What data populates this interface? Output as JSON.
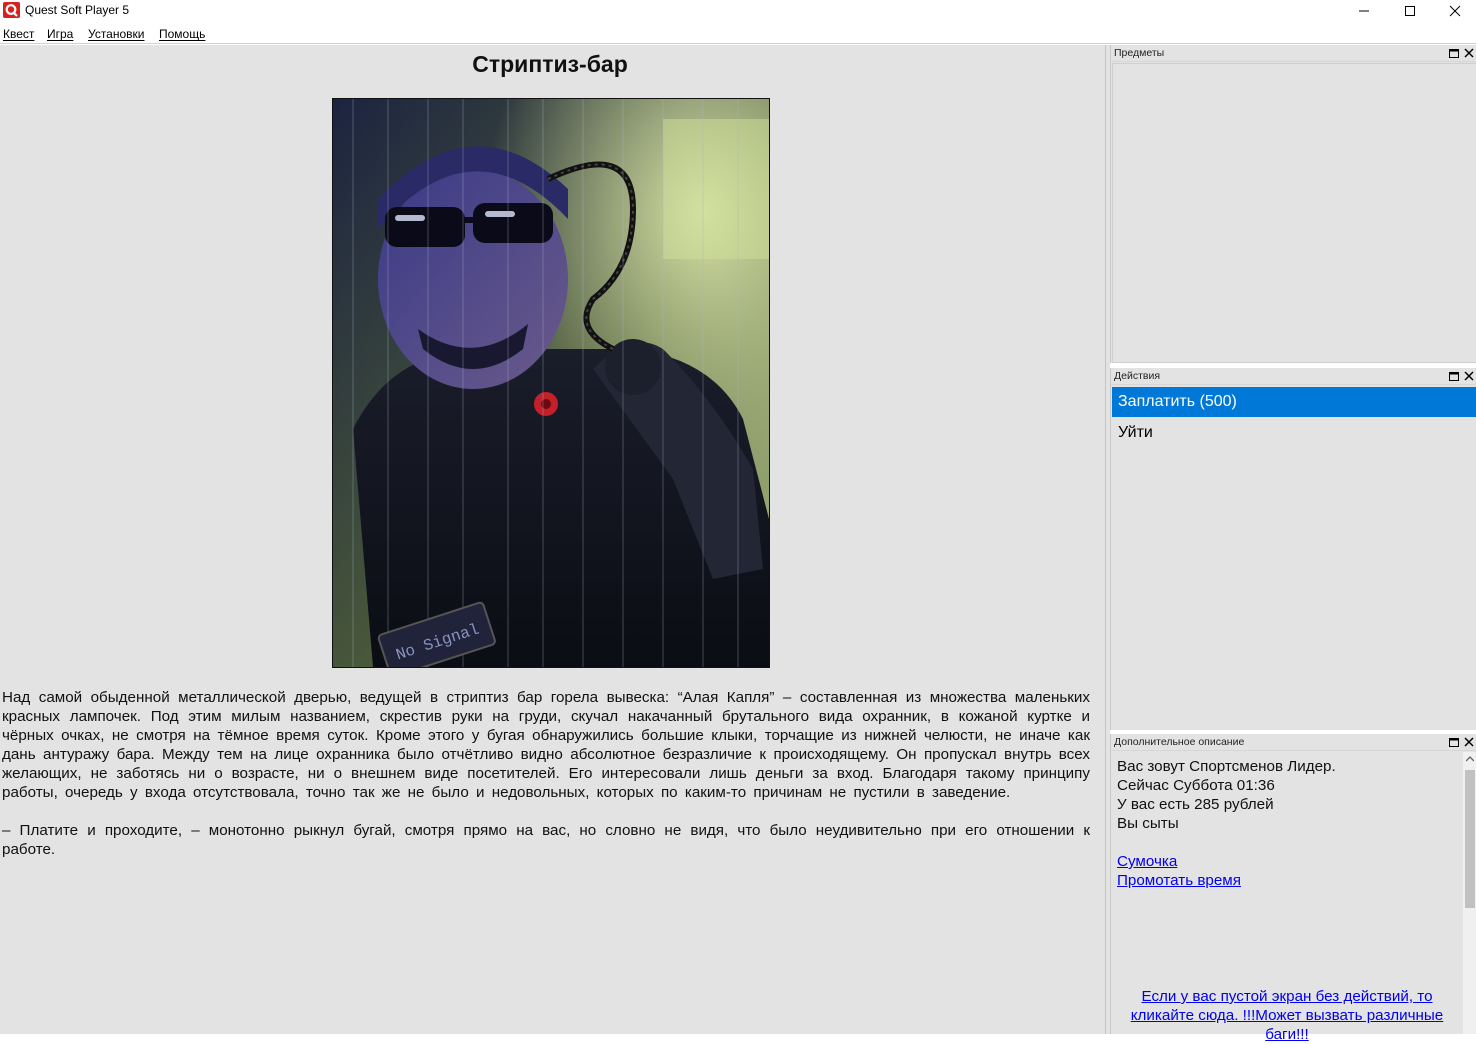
{
  "window": {
    "title": "Quest Soft Player 5"
  },
  "menu": {
    "items": [
      {
        "label": "Квест"
      },
      {
        "label": "Игра"
      },
      {
        "label": "Установки"
      },
      {
        "label": "Помощь"
      }
    ]
  },
  "scene": {
    "title": "Стриптиз-бар",
    "image_badge": "No Signal",
    "paragraphs": [
      "Над самой обыденной металлической дверью, ведущей в стриптиз бар горела вывеска: “Алая Капля” – составленная из множества маленьких красных лампочек. Под этим милым названием, скрестив руки на груди, скучал накачанный брутального вида охранник, в кожаной куртке и чёрных очках, не смотря на тёмное время суток. Кроме этого у бугая обнаружились большие клыки, торчащие из нижней челюсти, не иначе как дань антуражу бара. Между тем на лице охранника было отчётливо видно абсолютное безразличие к происходящему. Он пропускал внутрь всех желающих, не заботясь ни о возрасте, ни о внешнем виде посетителей. Его интересовали лишь деньги за вход. Благодаря такому принципу работы, очередь у входа отсутствовала, точно так же не было и недовольных, которых по каким-то причинам не пустили в заведение.",
      "– Платите и проходите, – монотонно рыкнул бугай, смотря прямо на вас, но словно не видя, что было неудивительно при его отношении к работе."
    ]
  },
  "panels": {
    "items": {
      "title": "Предметы"
    },
    "actions": {
      "title": "Действия",
      "list": [
        {
          "label": "Заплатить (500)",
          "selected": true
        },
        {
          "label": "Уйти",
          "selected": false
        }
      ]
    },
    "description": {
      "title": "Дополнительное описание",
      "lines": [
        "Вас зовут Спортсменов Лидер.",
        "Сейчас Суббота 01:36",
        "У вас есть 285 рублей",
        "Вы сыты"
      ],
      "links": [
        "Сумочка",
        "Промотать время"
      ],
      "warning": "Если у вас пустой экран без действий, то кликайте сюда. !!!Может вызвать различные баги!!!"
    }
  },
  "colors": {
    "selection": "#0078d7",
    "link": "#0000ee",
    "background": "#e3e3e3"
  }
}
